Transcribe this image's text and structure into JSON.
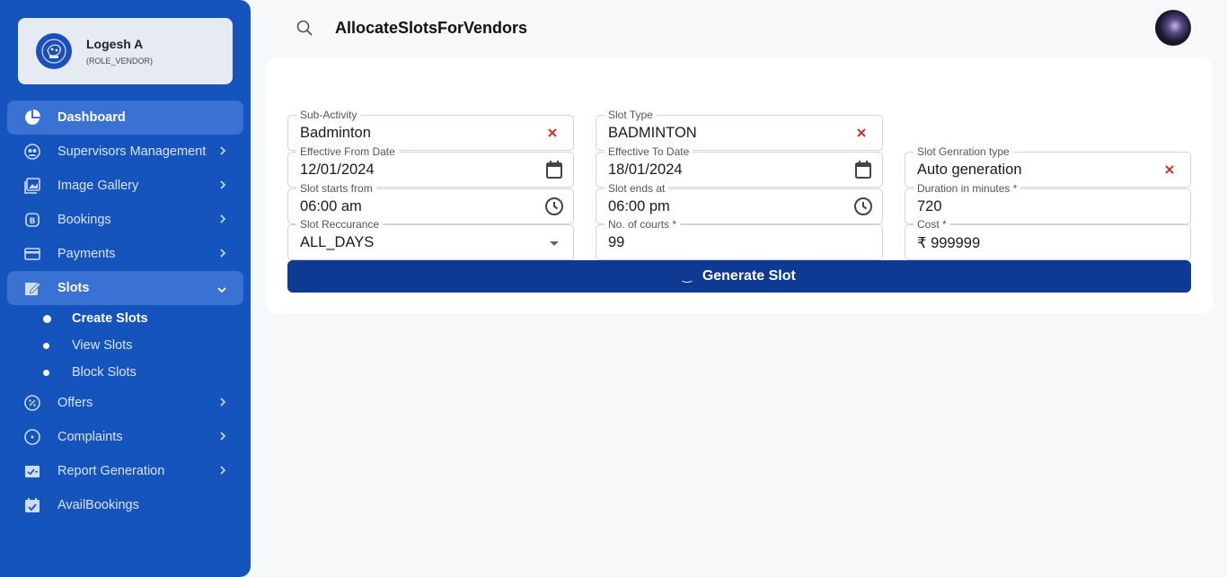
{
  "user": {
    "name": "Logesh A",
    "role": "(ROLE_VENDOR)"
  },
  "header": {
    "title": "AllocateSlotsForVendors"
  },
  "nav": {
    "dashboard": "Dashboard",
    "supervisors": "Supervisors Management",
    "gallery": "Image Gallery",
    "bookings": "Bookings",
    "payments": "Payments",
    "slots": "Slots",
    "slots_sub": [
      "Create Slots",
      "View Slots",
      "Block Slots"
    ],
    "offers": "Offers",
    "complaints": "Complaints",
    "reports": "Report Generation",
    "avail": "AvailBookings"
  },
  "form": {
    "sub_activity": {
      "label": "Sub-Activity",
      "value": "Badminton"
    },
    "slot_type": {
      "label": "Slot Type",
      "value": "BADMINTON"
    },
    "from_date": {
      "label": "Effective From Date",
      "value": "12/01/2024"
    },
    "to_date": {
      "label": "Effective To Date",
      "value": "18/01/2024"
    },
    "gen_type": {
      "label": "Slot Genration type",
      "value": "Auto generation"
    },
    "starts": {
      "label": "Slot starts from",
      "value": "06:00 am"
    },
    "ends": {
      "label": "Slot ends at",
      "value": "06:00 pm"
    },
    "duration": {
      "label": "Duration in minutes *",
      "value": "720"
    },
    "recurrence": {
      "label": "Slot Reccurance",
      "value": "ALL_DAYS"
    },
    "courts": {
      "label": "No. of courts *",
      "value": "99"
    },
    "cost": {
      "label": "Cost *",
      "value": "₹ 999999"
    }
  },
  "actions": {
    "generate": "Generate Slot",
    "spinner": "‿"
  },
  "colors": {
    "sidebar": "#1553bd",
    "active": "#3a72d4",
    "button": "#0f3a93",
    "clear": "#d32f2f"
  }
}
